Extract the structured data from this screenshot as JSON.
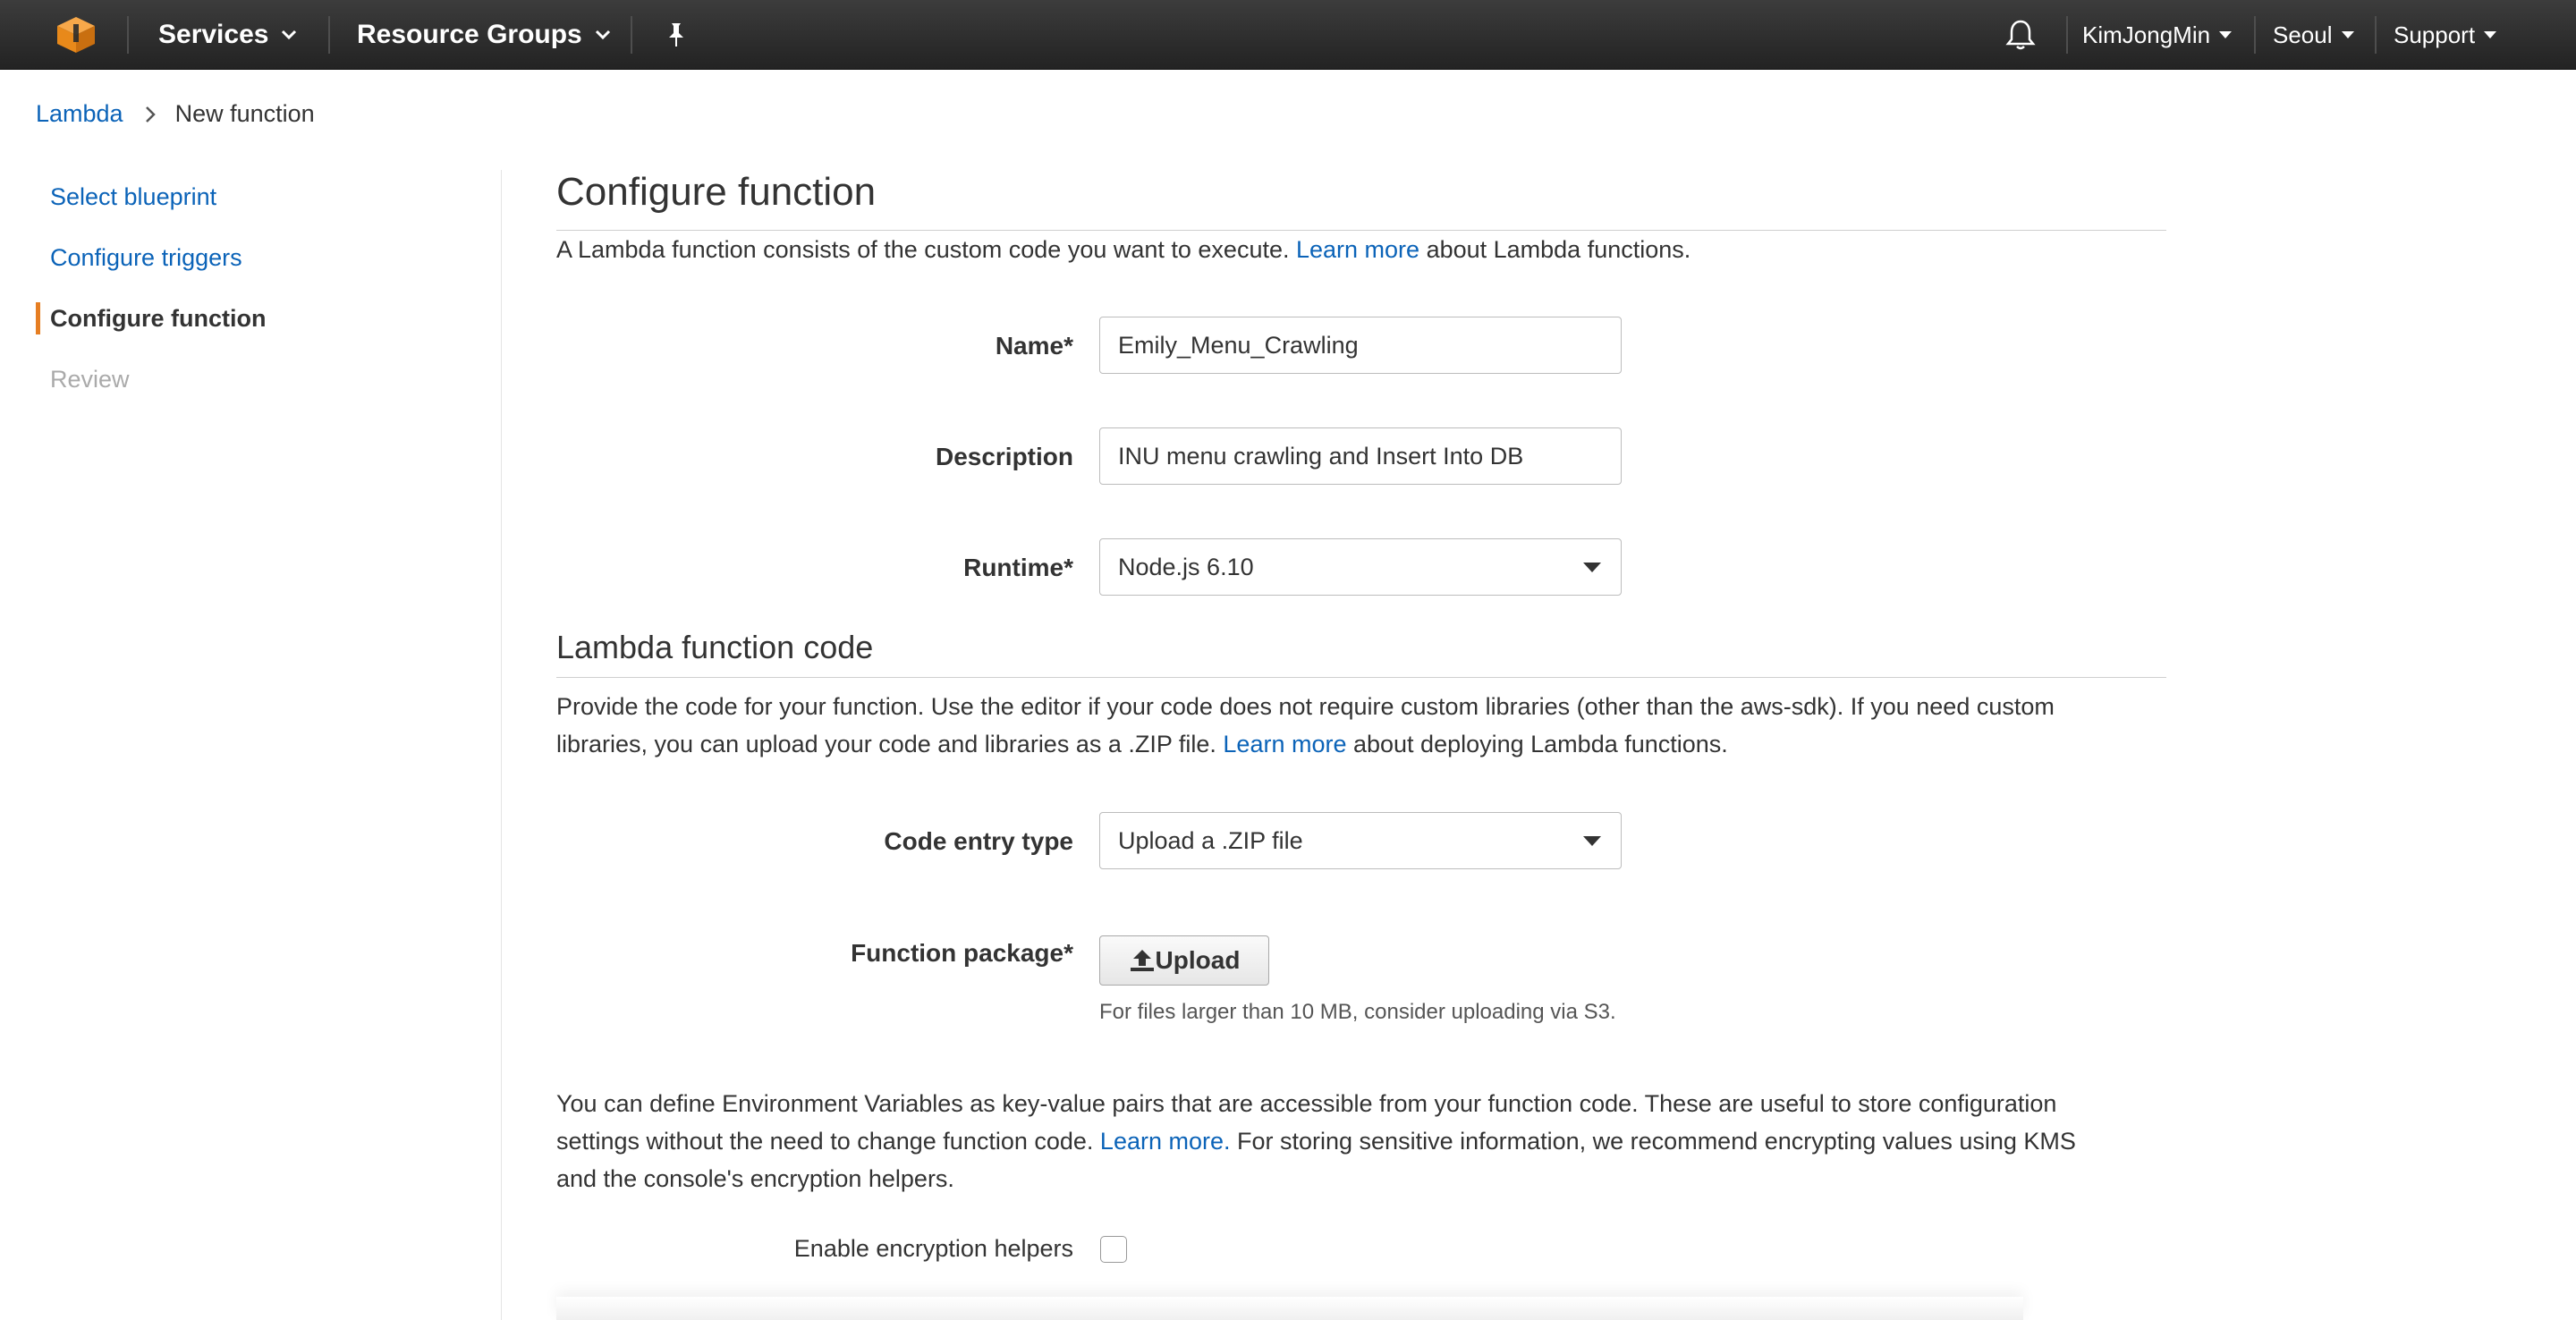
{
  "topnav": {
    "services": "Services",
    "resource_groups": "Resource Groups",
    "user": "KimJongMin",
    "region": "Seoul",
    "support": "Support"
  },
  "breadcrumb": {
    "root": "Lambda",
    "current": "New function"
  },
  "steps": [
    {
      "label": "Select blueprint",
      "state": "link"
    },
    {
      "label": "Configure triggers",
      "state": "link"
    },
    {
      "label": "Configure function",
      "state": "active"
    },
    {
      "label": "Review",
      "state": "disabled"
    }
  ],
  "configure": {
    "title": "Configure function",
    "intro_before": "A Lambda function consists of the custom code you want to execute. ",
    "intro_link": "Learn more",
    "intro_after": " about Lambda functions.",
    "name_label": "Name*",
    "name_value": "Emily_Menu_Crawling",
    "description_label": "Description",
    "description_value": "INU menu crawling and Insert Into DB",
    "runtime_label": "Runtime*",
    "runtime_value": "Node.js 6.10"
  },
  "code": {
    "title": "Lambda function code",
    "para_line1": "Provide the code for your function. Use the editor if your code does not require custom libraries (other than the aws-sdk). If you need custom",
    "para_line2_before": "libraries, you can upload your code and libraries as a .ZIP file. ",
    "para_link": "Learn more",
    "para_line2_after": " about deploying Lambda functions.",
    "entry_type_label": "Code entry type",
    "entry_type_value": "Upload a .ZIP file",
    "package_label": "Function package*",
    "upload_label": "Upload",
    "upload_hint": "For files larger than 10 MB, consider uploading via S3."
  },
  "env": {
    "line1": "You can define Environment Variables as key-value pairs that are accessible from your function code. These are useful to store configuration",
    "line2_before": "settings without the need to change function code. ",
    "line2_link": "Learn more.",
    "line2_after": " For storing sensitive information, we recommend encrypting values using KMS",
    "line3": "and the console's encryption helpers.",
    "encryption_label": "Enable encryption helpers",
    "encryption_checked": false
  },
  "colors": {
    "link": "#0b63b8",
    "accent": "#e67e22",
    "topbar": "#2b2b2b",
    "aws_logo": "#f29111"
  }
}
